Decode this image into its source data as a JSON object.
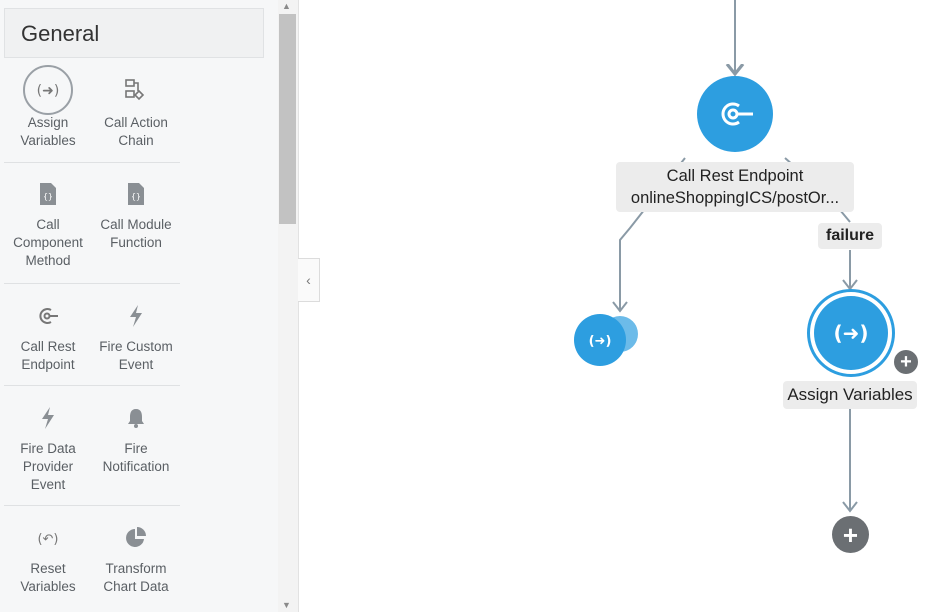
{
  "palette": {
    "header": "General",
    "items": [
      {
        "label": "Assign\nVariables",
        "icon": "assign-variables-icon"
      },
      {
        "label": "Call Action\nChain",
        "icon": "action-chain-icon"
      },
      {
        "label": "Call\nComponent\nMethod",
        "icon": "document-code-icon"
      },
      {
        "label": "Call Module\nFunction",
        "icon": "document-code-icon"
      },
      {
        "label": "Call Rest\nEndpoint",
        "icon": "rest-endpoint-icon"
      },
      {
        "label": "Fire Custom\nEvent",
        "icon": "lightning-icon"
      },
      {
        "label": "Fire Data\nProvider\nEvent",
        "icon": "lightning-icon"
      },
      {
        "label": "Fire\nNotification",
        "icon": "bell-icon"
      },
      {
        "label": "Reset\nVariables",
        "icon": "reset-icon"
      },
      {
        "label": "Transform\nChart Data",
        "icon": "pie-chart-icon"
      }
    ]
  },
  "canvas": {
    "rest_node_label_line1": "Call Rest Endpoint",
    "rest_node_label_line2": "onlineShoppingICS/postOr...",
    "failure_label": "failure",
    "assign_node_label": "Assign Variables"
  },
  "colors": {
    "accent": "#2d9ee0",
    "connector": "#8a9aa6",
    "add_button": "#6b6f73"
  }
}
